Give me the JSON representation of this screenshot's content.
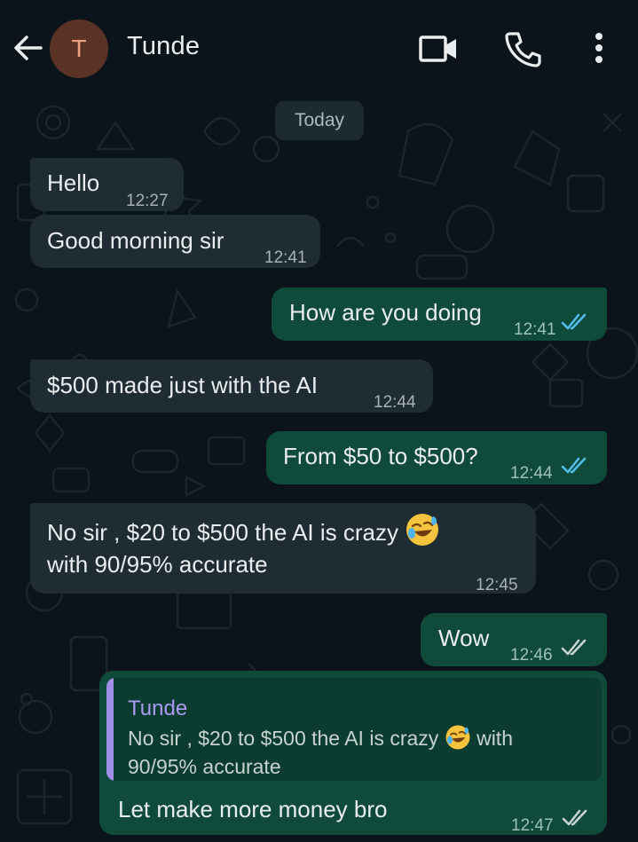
{
  "header": {
    "avatar_initial": "T",
    "contact_name": "Tunde",
    "icons": [
      "back-arrow-icon",
      "video-camera-icon",
      "phone-icon",
      "more-vertical-icon"
    ]
  },
  "chat": {
    "date_chip": "Today",
    "messages": [
      {
        "direction": "in",
        "text": "Hello",
        "time": "12:27"
      },
      {
        "direction": "in",
        "text": "Good morning sir",
        "time": "12:41"
      },
      {
        "direction": "out",
        "text": "How are you doing",
        "time": "12:41",
        "status": "read"
      },
      {
        "direction": "in",
        "text": "$500 made just with the AI",
        "time": "12:44"
      },
      {
        "direction": "out",
        "text": "From $50 to $500?",
        "time": "12:44",
        "status": "read"
      },
      {
        "direction": "in",
        "text_line1": "No sir , $20 to $500 the AI is crazy",
        "text_line2": "with 90/95% accurate",
        "emoji": "rolling-on-floor-laughing",
        "time": "12:45"
      },
      {
        "direction": "out",
        "text": "Wow",
        "time": "12:46",
        "status": "delivered"
      },
      {
        "direction": "out",
        "quote": {
          "author": "Tunde",
          "line1_before": "No sir , $20 to $500 the AI is crazy",
          "line1_after": "with",
          "line2": "90/95% accurate"
        },
        "text": "Let make more money bro",
        "time": "12:47",
        "status": "delivered"
      }
    ]
  },
  "colors": {
    "background": "#0b141a",
    "incoming_bubble": "#202c33",
    "outgoing_bubble": "#0f4a3b",
    "read_ticks": "#53bdeb",
    "delivered_ticks": "#c8d2cf",
    "quote_accent": "#9f8fe6"
  }
}
